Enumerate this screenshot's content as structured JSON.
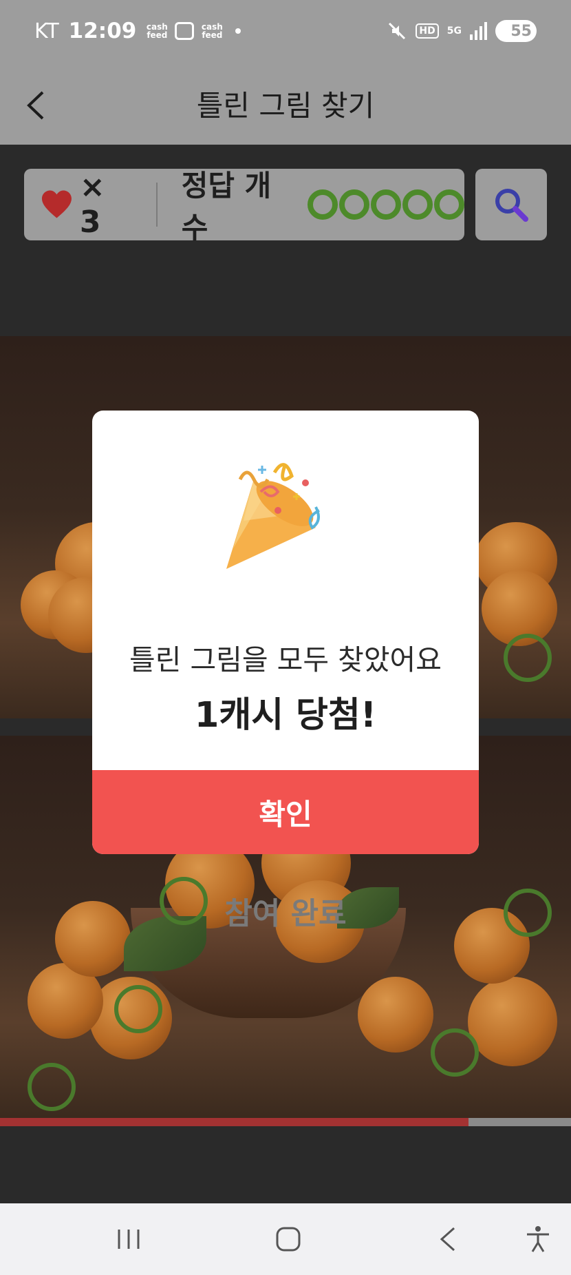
{
  "status_bar": {
    "carrier": "KT",
    "time": "12:09",
    "app_badge_1": "cash feed",
    "app_badge_2": "cash feed",
    "hd_label": "HD",
    "network_label": "5G",
    "battery": "55"
  },
  "header": {
    "title": "틀린 그림 찾기",
    "back_icon": "chevron-left-icon"
  },
  "score": {
    "heart_icon": "heart-icon",
    "lives": "× 3",
    "answer_label": "정답 개수",
    "answers_found": 5,
    "answers_total": 5,
    "hint_icon": "magnifier-icon"
  },
  "game": {
    "status_label": "참여 완료",
    "progress_percent": 82
  },
  "modal": {
    "illustration": "party-popper-icon",
    "message": "틀린 그림을 모두 찾았어요",
    "reward": "1캐시 당첨!",
    "confirm_label": "확인"
  },
  "nav_bar": {
    "recent_icon": "recent-apps-icon",
    "home_icon": "home-icon",
    "back_icon": "back-icon",
    "accessibility_icon": "accessibility-icon"
  },
  "colors": {
    "accent_red": "#f25350",
    "correct_green": "#4d8a2a",
    "hint_blue": "#3a3fa8"
  }
}
